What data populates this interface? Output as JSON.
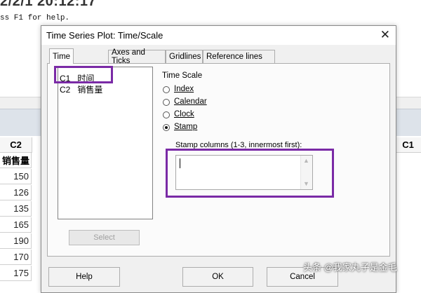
{
  "background": {
    "timestamp_fragment": "2/2/1 20:12:17",
    "help_line": "ss F1 for help.",
    "worksheet": {
      "col_hdr_c2": "C2",
      "col_hdr_c1": "C1",
      "col_name": "销售量",
      "values": [
        "150",
        "126",
        "135",
        "165",
        "190",
        "170",
        "175"
      ]
    }
  },
  "dialog": {
    "title": "Time Series Plot: Time/Scale",
    "tabs": [
      "Time",
      "Axes and Ticks",
      "Gridlines",
      "Reference lines"
    ],
    "variables": [
      {
        "id": "C1",
        "name": "时间"
      },
      {
        "id": "C2",
        "name": "销售量"
      }
    ],
    "select_label": "Select",
    "time_scale": {
      "label": "Time Scale",
      "options": [
        "Index",
        "Calendar",
        "Clock",
        "Stamp"
      ],
      "selected": "Stamp"
    },
    "stamp_label": "Stamp columns (1-3, innermost first):",
    "stamp_value": "",
    "buttons": {
      "help": "Help",
      "ok": "OK",
      "cancel": "Cancel"
    }
  },
  "highlight_color": "#7a2aa6",
  "watermark": "头条 @我家丸子是金毛"
}
